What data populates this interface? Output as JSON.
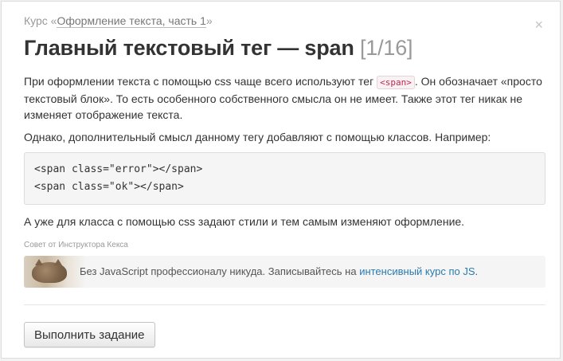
{
  "header": {
    "breadcrumb_prefix": "Курс «",
    "breadcrumb_link": "Оформление текста, часть 1",
    "breadcrumb_suffix": "»",
    "title": "Главный текстовый тег — span",
    "counter": "[1/16]",
    "close_symbol": "×"
  },
  "content": {
    "p1_before": "При оформлении текста с помощью css чаще всего используют тег ",
    "p1_code": "<span>",
    "p1_after": ". Он обозначает «просто текстовый блок». То есть особенного собственного смысла он не имеет. Также этот тег никак не изменяет отображение текста.",
    "p2": "Однако, дополнительный смысл данному тегу добавляют с помощью классов. Например:",
    "code_lines": [
      "<span class=\"error\"></span>",
      "<span class=\"ok\"></span>"
    ],
    "p3": "А уже для класса с помощью css задают стили и тем самым изменяют оформление."
  },
  "tip": {
    "label": "Совет от Инструктора Кекса",
    "text_before": "Без JavaScript профессионалу никуда. Записывайтесь на ",
    "link": "интенсивный курс по JS",
    "text_after": ".",
    "image_icon": "cat-photo"
  },
  "actions": {
    "submit_label": "Выполнить задание"
  }
}
